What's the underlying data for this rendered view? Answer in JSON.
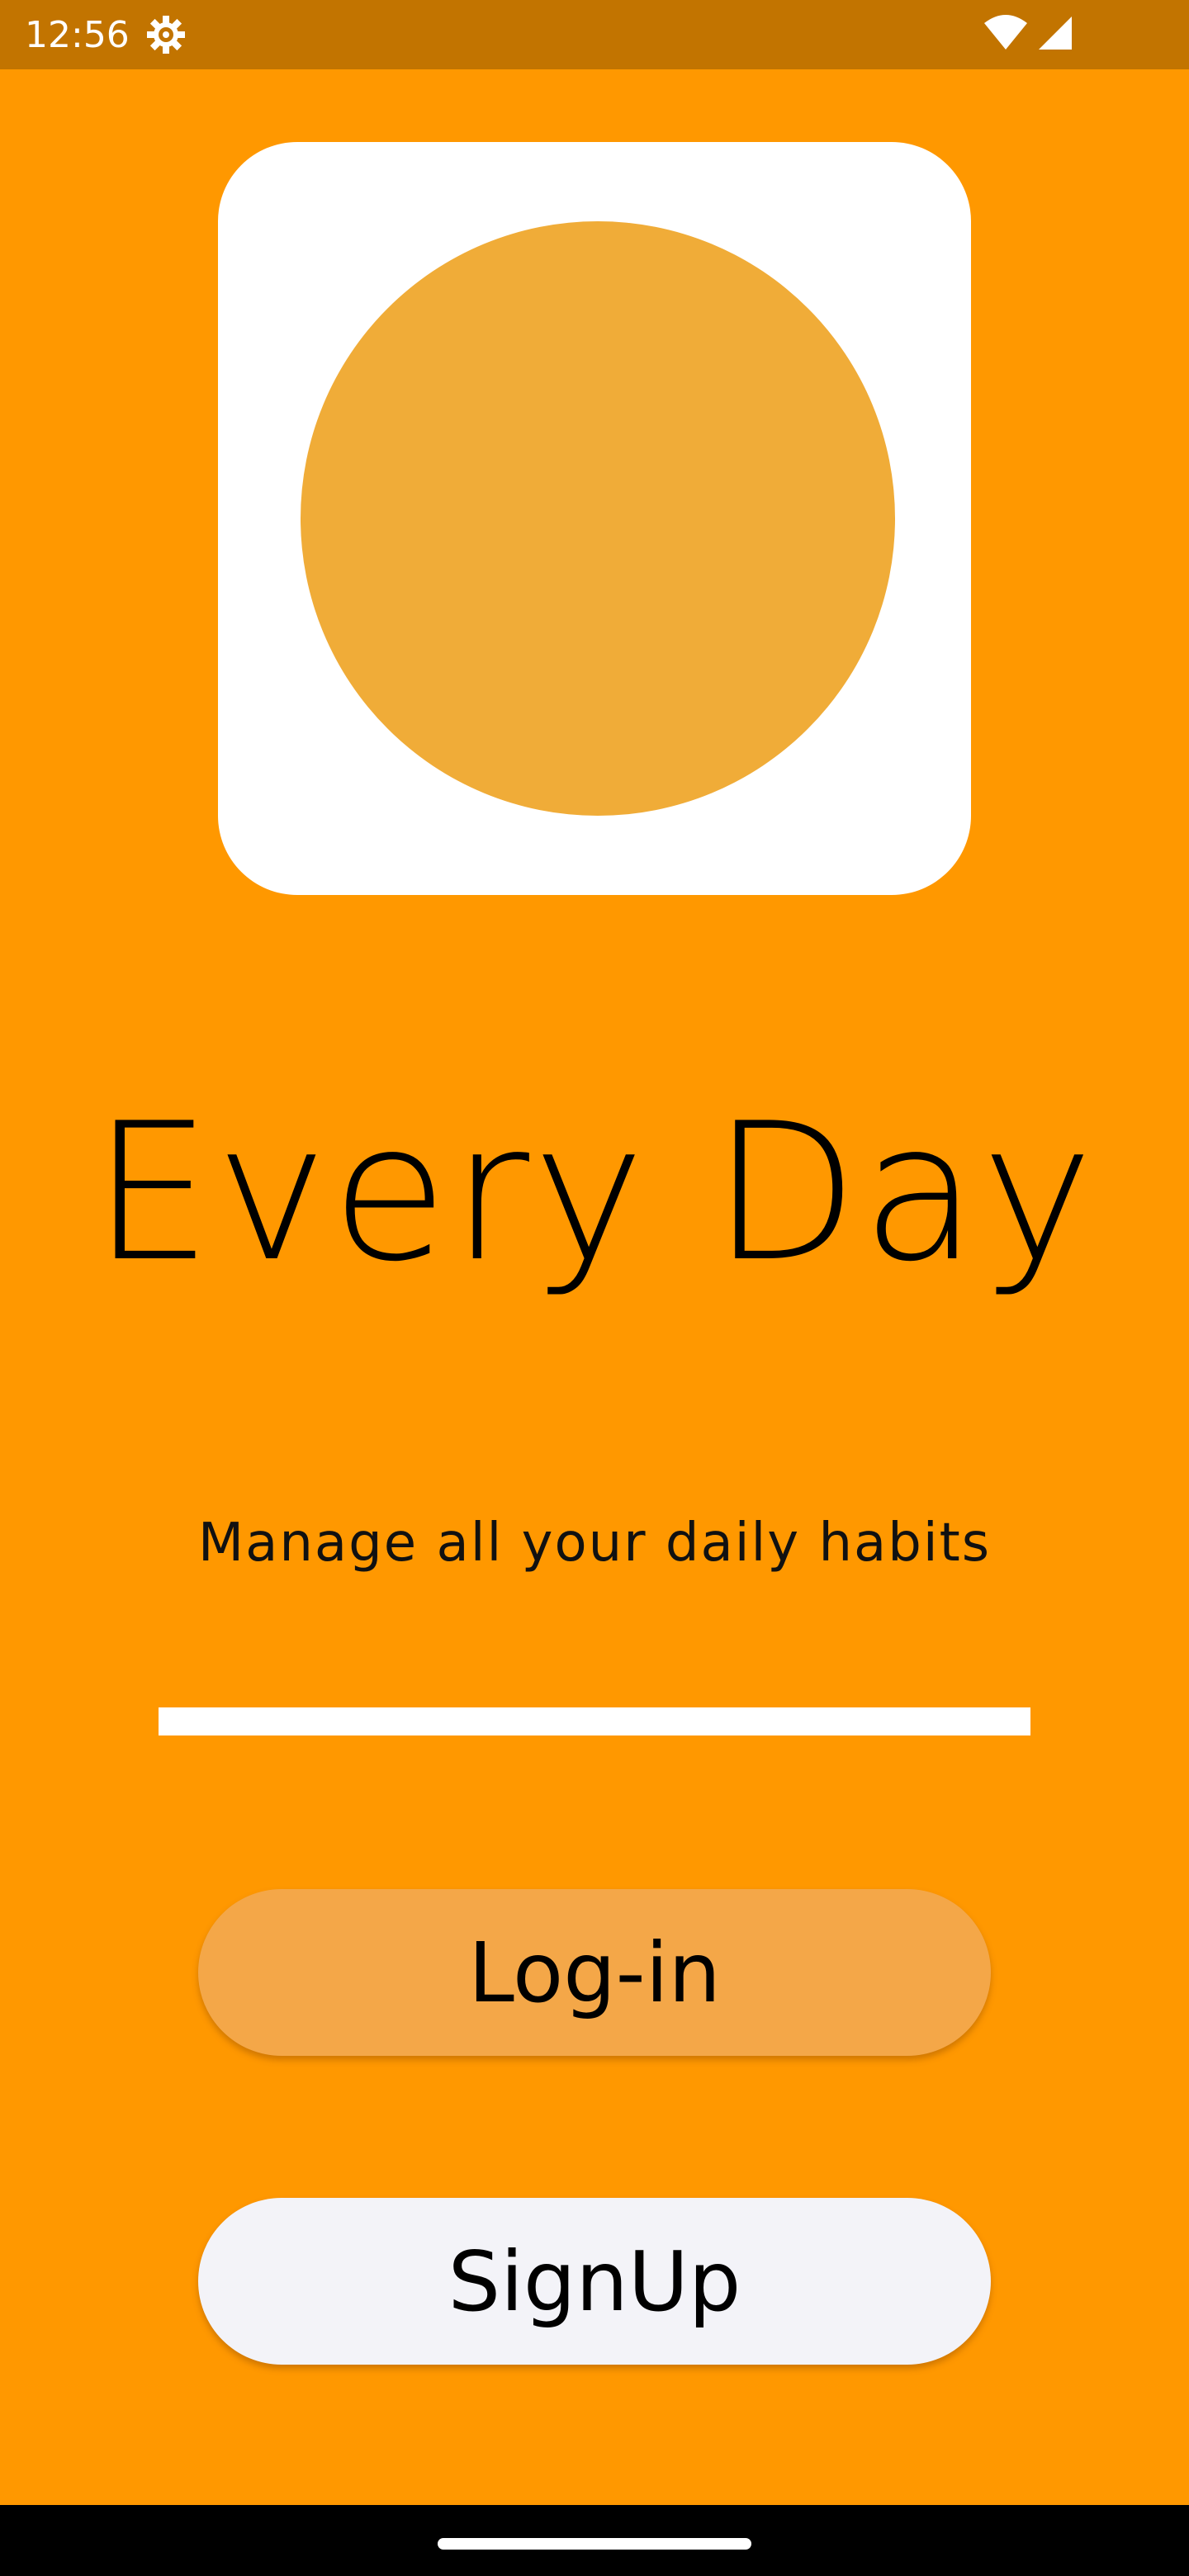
{
  "colors": {
    "status_bar_bg": "#C27400",
    "app_bg": "#FF9800",
    "logo_circle": "#F0AC38",
    "login_button_bg": "#F4A748",
    "signup_button_bg": "#F3F3F8",
    "text": "#000000"
  },
  "status_bar": {
    "time": "12:56",
    "icons": [
      "settings-icon",
      "wifi-icon",
      "signal-icon"
    ]
  },
  "logo": {
    "icon": "app-logo-circle"
  },
  "title": "Every Day",
  "tagline": "Manage all your daily habits",
  "buttons": {
    "login_label": "Log-in",
    "signup_label": "SignUp"
  },
  "nav_bar": {
    "icons": [
      "home-handle"
    ]
  }
}
